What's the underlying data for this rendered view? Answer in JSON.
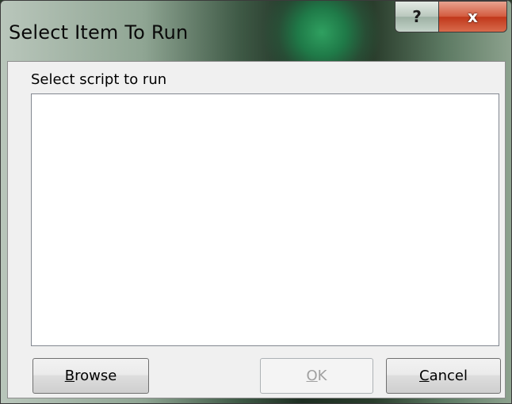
{
  "window": {
    "title": "Select Item To Run",
    "help_glyph": "?",
    "close_glyph": "x"
  },
  "dialog": {
    "prompt_label": "Select script to run",
    "script_list_items": []
  },
  "buttons": {
    "browse": {
      "accel": "B",
      "rest": "rowse",
      "enabled": true
    },
    "ok": {
      "accel": "O",
      "rest": "K",
      "enabled": false
    },
    "cancel": {
      "accel": "C",
      "rest": "ancel",
      "enabled": true
    }
  },
  "colors": {
    "close_button": "#c0371a",
    "dialog_background": "#f0f0f0",
    "list_background": "#ffffff",
    "disabled_text": "#a0a0a0"
  }
}
